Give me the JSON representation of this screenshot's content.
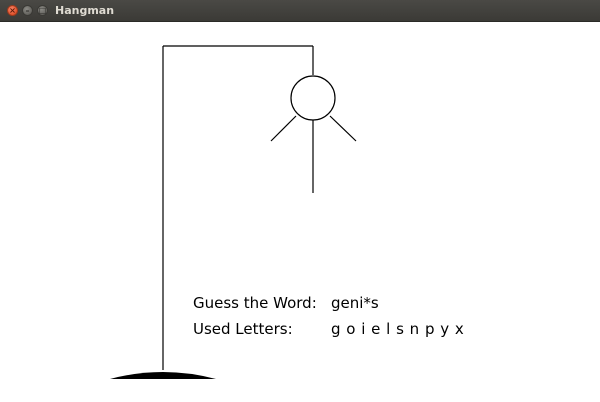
{
  "window": {
    "title": "Hangman",
    "controls": {
      "close_glyph": "×",
      "minimize_glyph": "–",
      "maximize_glyph": "□"
    }
  },
  "game": {
    "word_label": "Guess the Word:",
    "word_value": "geni*s",
    "used_label": "Used Letters:",
    "used_value": "g o i e l s n p y x"
  },
  "hangman_drawing": {
    "parts_shown": [
      "base",
      "pole",
      "beam",
      "rope",
      "head",
      "body",
      "left-arm",
      "right-arm"
    ],
    "stroke_color": "#000000",
    "fill_color": "#000000"
  }
}
